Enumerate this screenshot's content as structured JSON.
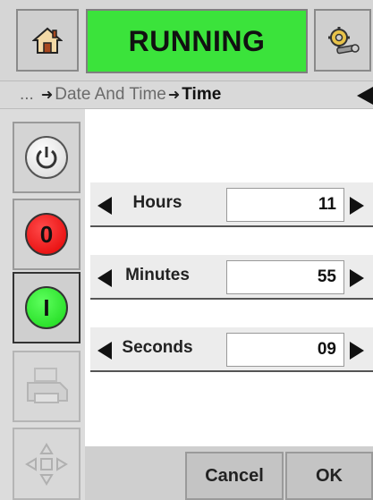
{
  "header": {
    "status_text": "RUNNING",
    "status_color": "#3be33b",
    "home_icon": "home-icon",
    "settings_icon": "gear-wrench-icon"
  },
  "breadcrumb": {
    "ellipsis": "...",
    "parent": "Date And Time",
    "current": "Time"
  },
  "sidebar": {
    "power_icon": "power-icon",
    "stop_label": "0",
    "stop_color": "#e20000",
    "start_label": "I",
    "start_color": "#19d619",
    "printer_icon": "printer-icon",
    "navigation_icon": "directional-pad-icon"
  },
  "time_fields": [
    {
      "label": "Hours",
      "value": "11"
    },
    {
      "label": "Minutes",
      "value": "55"
    },
    {
      "label": "Seconds",
      "value": "09"
    }
  ],
  "actions": {
    "cancel_label": "Cancel",
    "ok_label": "OK"
  }
}
